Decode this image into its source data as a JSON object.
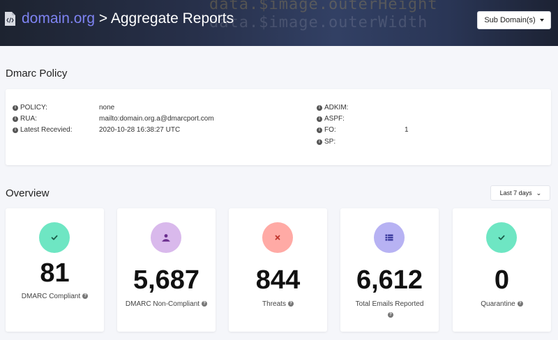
{
  "header": {
    "domain": "domain.org",
    "separator": ">",
    "page_title": "Aggregate Reports",
    "subdomain_button": "Sub Domain(s)",
    "code_line_1": "data.$image.outerHeight",
    "code_line_2": "data.$image.outerWidth"
  },
  "policy": {
    "title": "Dmarc Policy",
    "left": [
      {
        "label": "POLICY:",
        "value": "none"
      },
      {
        "label": "RUA:",
        "value": "mailto:domain.org.a@dmarcport.com"
      },
      {
        "label": "Latest Recevied:",
        "value": "2020-10-28 16:38:27 UTC"
      }
    ],
    "right": [
      {
        "label": "ADKIM:",
        "value": ""
      },
      {
        "label": "ASPF:",
        "value": ""
      },
      {
        "label": "FO:",
        "value": "1"
      },
      {
        "label": "SP:",
        "value": ""
      }
    ]
  },
  "overview": {
    "title": "Overview",
    "range_button": "Last 7 days",
    "stats": [
      {
        "value": "81",
        "label": "DMARC Compliant",
        "icon": "check-icon",
        "icon_bg": "#6ee6c3",
        "icon_color": "#1a5c49"
      },
      {
        "value": "5,687",
        "label": "DMARC Non-Compliant",
        "icon": "user-icon",
        "icon_bg": "#d9b9ec",
        "icon_color": "#6a2d8e"
      },
      {
        "value": "844",
        "label": "Threats",
        "icon": "close-icon",
        "icon_bg": "#ffaaa5",
        "icon_color": "#c0332b"
      },
      {
        "value": "6,612",
        "label": "Total Emails Reported",
        "icon": "list-icon",
        "icon_bg": "#b7b2f3",
        "icon_color": "#3b3a9e"
      },
      {
        "value": "0",
        "label": "Quarantine",
        "icon": "check-icon",
        "icon_bg": "#6ee6c3",
        "icon_color": "#1a5c49"
      }
    ]
  }
}
